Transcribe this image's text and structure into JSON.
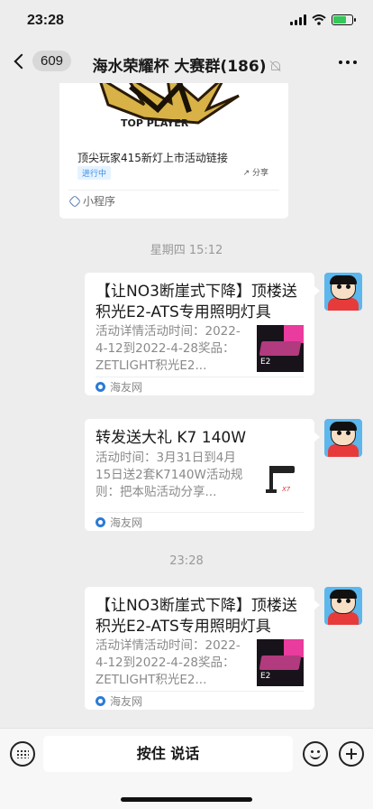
{
  "status_bar": {
    "time": "23:28"
  },
  "nav": {
    "back_count": "609",
    "title": "海水荣耀杯 大赛群(186)"
  },
  "messages": {
    "mini_program": {
      "banner_text": "TOP PLAYER",
      "title": "顶尖玩家415新灯上市活动链接",
      "status_tag": "进行中",
      "share_label": "分享",
      "footer_label": "小程序"
    },
    "timestamp_1": "星期四 15:12",
    "card_1": {
      "title": "【让NO3断崖式下降】顶楼送积光E2-ATS专用照明灯具",
      "description": "活动详情活动时间：2022-4-12到2022-4-28奖品：ZETLIGHT积光E2...",
      "thumb_label": "E2",
      "source": "海友网"
    },
    "card_2": {
      "title": "转发送大礼 K7 140W",
      "description": "活动时间：3月31日到4月15日送2套K7140W活动规则：把本贴活动分享...",
      "thumb_label": "X7",
      "source": "海友网"
    },
    "timestamp_2": "23:28",
    "card_3": {
      "title": "【让NO3断崖式下降】顶楼送积光E2-ATS专用照明灯具",
      "description": "活动详情活动时间：2022-4-12到2022-4-28奖品：ZETLIGHT积光E2...",
      "thumb_label": "E2",
      "source": "海友网"
    }
  },
  "input_bar": {
    "hold_to_talk": "按住 说话"
  },
  "colors": {
    "background": "#ededed",
    "card": "#ffffff",
    "battery": "#34c759",
    "link_source": "#2b7bd6"
  }
}
